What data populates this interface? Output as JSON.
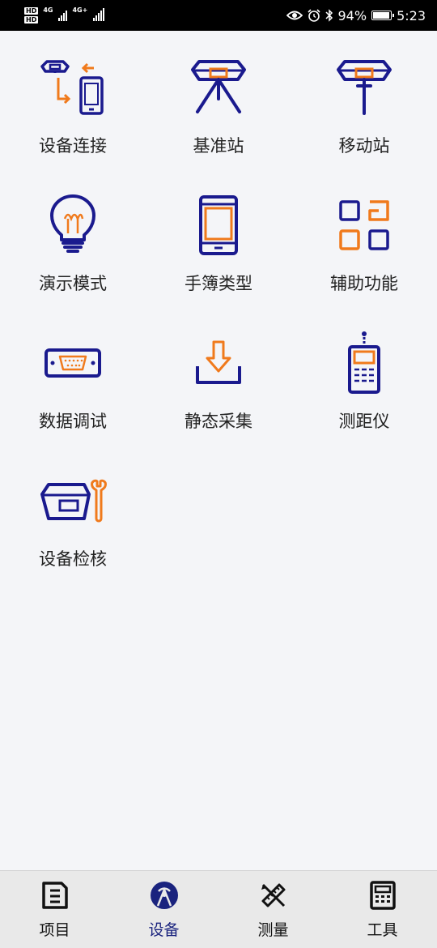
{
  "status_bar": {
    "hd1": "HD",
    "hd2": "HD",
    "net1": "4G",
    "net2": "4G+",
    "battery": "94%",
    "battery_level": 0.94,
    "time": "5:23",
    "icons": [
      "eye-icon",
      "alarm-icon",
      "bluetooth-icon"
    ]
  },
  "colors": {
    "accent": "#1a237e",
    "icon_blue": "#1a1a8e",
    "icon_orange": "#f07a1c",
    "background": "#f4f5f8",
    "nav_background": "#e9e9e9"
  },
  "tiles": [
    {
      "label": "设备连接",
      "icon": "device-connect-icon"
    },
    {
      "label": "基准站",
      "icon": "base-station-icon"
    },
    {
      "label": "移动站",
      "icon": "rover-station-icon"
    },
    {
      "label": "演示模式",
      "icon": "lightbulb-icon"
    },
    {
      "label": "手簿类型",
      "icon": "handheld-icon"
    },
    {
      "label": "辅助功能",
      "icon": "grid-squares-icon"
    },
    {
      "label": "数据调试",
      "icon": "serial-port-icon"
    },
    {
      "label": "静态采集",
      "icon": "download-icon"
    },
    {
      "label": "测距仪",
      "icon": "rangefinder-icon"
    },
    {
      "label": "设备检核",
      "icon": "device-check-icon"
    }
  ],
  "bottom_nav": [
    {
      "label": "项目",
      "icon": "clipboard-icon",
      "active": false
    },
    {
      "label": "设备",
      "icon": "antenna-icon",
      "active": true
    },
    {
      "label": "测量",
      "icon": "pencil-ruler-icon",
      "active": false
    },
    {
      "label": "工具",
      "icon": "calculator-icon",
      "active": false
    }
  ]
}
